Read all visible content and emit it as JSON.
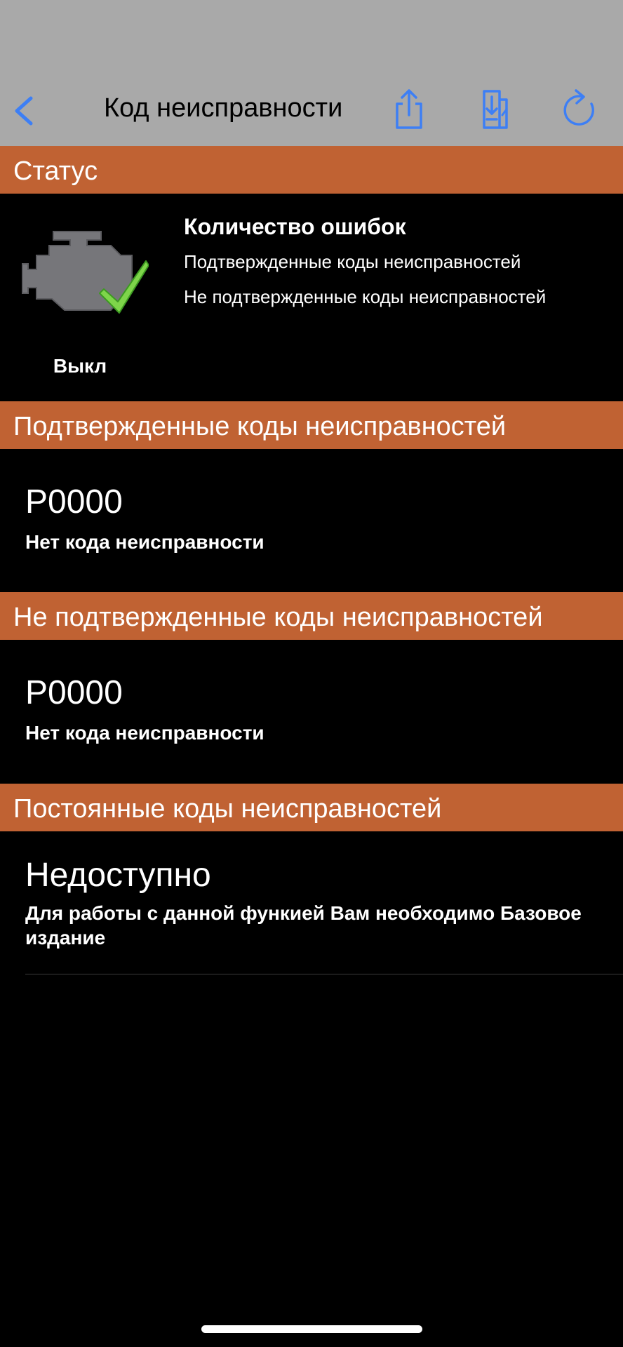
{
  "nav": {
    "title": "Код неисправности",
    "icon_color": "#3d7ff5"
  },
  "status_section": {
    "header": "Статус",
    "engine_state": "Выкл",
    "count_title": "Количество ошибок",
    "confirmed_line": "Подтвержденные коды неисправностей",
    "unconfirmed_line": "Не подтвержденные коды неисправностей"
  },
  "confirmed_section": {
    "header": "Подтвержденные коды неисправностей",
    "code": "P0000",
    "description": "Нет кода неисправности"
  },
  "pending_section": {
    "header": "Не подтвержденные коды неисправностей",
    "code": "P0000",
    "description": "Нет кода неисправности"
  },
  "permanent_section": {
    "header": "Постоянные коды неисправностей",
    "code": "Недоступно",
    "description": "Для работы с данной функией Вам необходимо Базовое издание"
  },
  "colors": {
    "header_bg": "#a9a9a9",
    "section_bg": "#c06233",
    "background": "#000000"
  }
}
